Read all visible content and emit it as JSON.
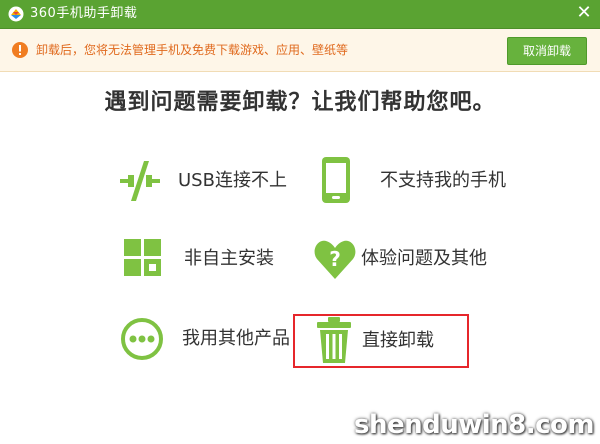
{
  "window": {
    "title": "360手机助手卸载",
    "close_glyph": "✕"
  },
  "warning": {
    "text": "卸载后，您将无法管理手机及免费下载游戏、应用、壁纸等",
    "cancel_label": "取消卸载",
    "accent_color": "#e06a1e"
  },
  "main": {
    "headline": "遇到问题需要卸载？让我们帮助您吧。",
    "options": [
      {
        "label": "USB连接不上",
        "icon": "usb-disconnect-icon"
      },
      {
        "label": "不支持我的手机",
        "icon": "phone-icon"
      },
      {
        "label": "非自主安装",
        "icon": "app-grid-icon"
      },
      {
        "label": "体验问题及其他",
        "icon": "heart-question-icon"
      },
      {
        "label": "我用其他产品",
        "icon": "chat-bubble-icon"
      },
      {
        "label": "直接卸载",
        "icon": "trash-icon"
      }
    ],
    "selected_option": "直接卸载",
    "brand_color": "#7fc242"
  },
  "watermark": {
    "text": "shenduwin8.com"
  }
}
